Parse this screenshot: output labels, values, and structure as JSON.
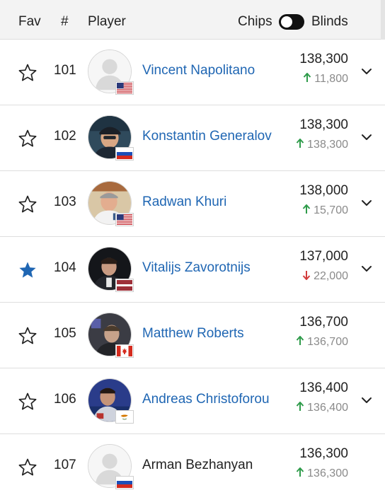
{
  "header": {
    "fav": "Fav",
    "rank": "#",
    "player": "Player",
    "chips": "Chips",
    "blinds": "Blinds"
  },
  "colors": {
    "link": "#1f66b3",
    "up": "#2e9b4a",
    "down": "#d23b3b",
    "star_active": "#1f66b3"
  },
  "rows": [
    {
      "rank": "101",
      "name": "Vincent Napolitano",
      "chips": "138,300",
      "delta": "11,800",
      "direction": "up",
      "fav": false,
      "linked": true,
      "expandable": true,
      "flag": "us",
      "avatar": "placeholder"
    },
    {
      "rank": "102",
      "name": "Konstantin Generalov",
      "chips": "138,300",
      "delta": "138,300",
      "direction": "up",
      "fav": false,
      "linked": true,
      "expandable": true,
      "flag": "ru",
      "avatar": "photo"
    },
    {
      "rank": "103",
      "name": "Radwan Khuri",
      "chips": "138,000",
      "delta": "15,700",
      "direction": "up",
      "fav": false,
      "linked": true,
      "expandable": true,
      "flag": "us",
      "avatar": "photo"
    },
    {
      "rank": "104",
      "name": "Vitalijs Zavorotnijs",
      "chips": "137,000",
      "delta": "22,000",
      "direction": "down",
      "fav": true,
      "linked": true,
      "expandable": true,
      "flag": "lv",
      "avatar": "photo"
    },
    {
      "rank": "105",
      "name": "Matthew Roberts",
      "chips": "136,700",
      "delta": "136,700",
      "direction": "up",
      "fav": false,
      "linked": true,
      "expandable": false,
      "flag": "ca",
      "avatar": "photo"
    },
    {
      "rank": "106",
      "name": "Andreas Christoforou",
      "chips": "136,400",
      "delta": "136,400",
      "direction": "up",
      "fav": false,
      "linked": true,
      "expandable": true,
      "flag": "cy",
      "avatar": "photo"
    },
    {
      "rank": "107",
      "name": "Arman Bezhanyan",
      "chips": "136,300",
      "delta": "136,300",
      "direction": "up",
      "fav": false,
      "linked": false,
      "expandable": false,
      "flag": "ru",
      "avatar": "placeholder"
    }
  ]
}
